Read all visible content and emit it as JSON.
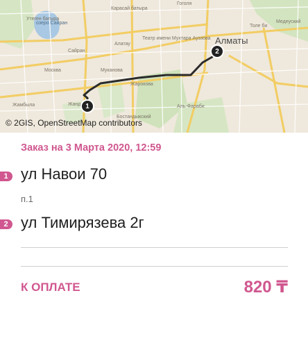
{
  "map": {
    "attribution": "© 2GIS, OpenStreetMap contributors",
    "start_marker": "1",
    "end_marker": "2",
    "route_color": "#2b2b2b",
    "labels": [
      "Карасай батыра",
      "Гоголя",
      "Толе би",
      "Театр имени Мухтара Ауэзова",
      "Алатау",
      "Сайран",
      "Москва",
      "Алматы",
      "Медеуский",
      "Жандосова",
      "Бостандыкский",
      "Жамбыла",
      "Жарокова",
      "Муканова",
      "Утеген батыра",
      "Аль-Фараби",
      "озеро Сайран"
    ]
  },
  "order": {
    "title": "Заказ на 3 Марта 2020, 12:59",
    "accent_color": "#d0578f"
  },
  "stops": [
    {
      "badge": "1",
      "address": "ул Навои 70",
      "detail": "п.1"
    },
    {
      "badge": "2",
      "address": "ул Тимирязева 2г",
      "detail": ""
    }
  ],
  "payment": {
    "label": "К ОПЛАТЕ",
    "amount": "820 ₸"
  }
}
